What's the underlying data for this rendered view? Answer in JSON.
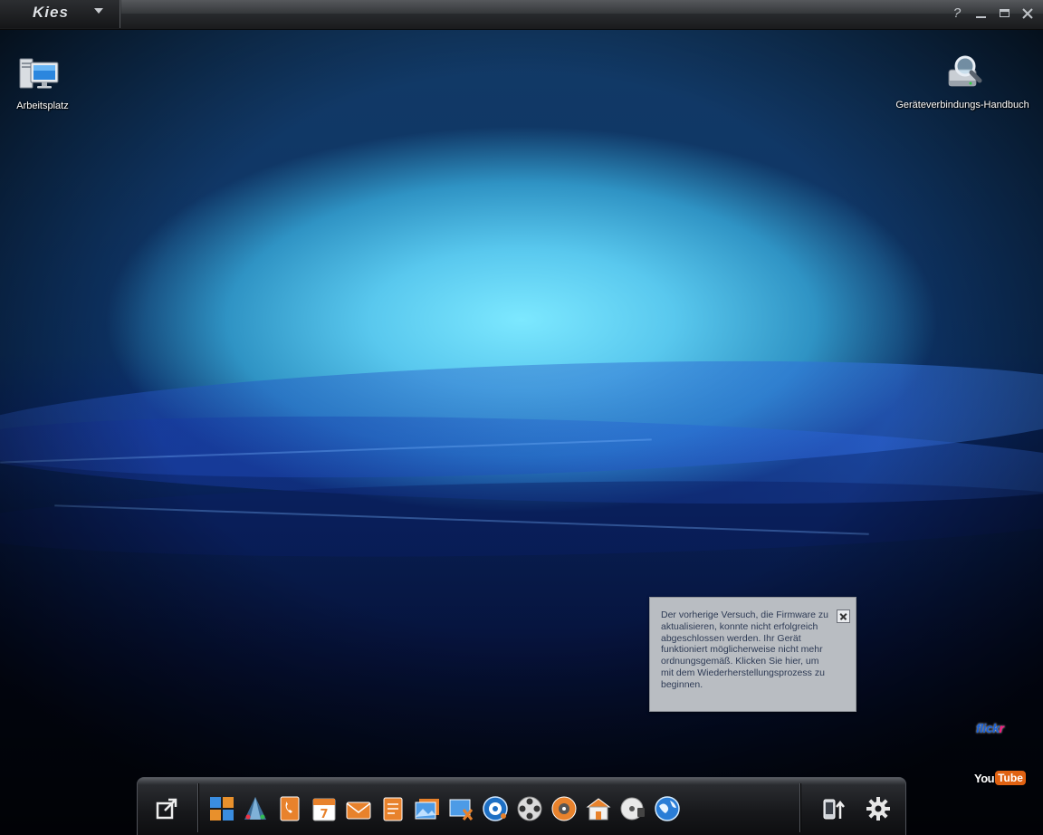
{
  "window": {
    "app_logo": "Kies",
    "controls": [
      "help-icon",
      "minimize-icon",
      "maximize-icon",
      "close-icon"
    ],
    "help_glyph": "?"
  },
  "desktop": {
    "icons": [
      {
        "label": "Arbeitsplatz",
        "icon": "computer-icon"
      },
      {
        "label": "Geräteverbindungs-Handbuch",
        "icon": "manual-search-icon"
      }
    ]
  },
  "notification": {
    "message": "Der vorherige Versuch, die Firmware zu aktualisieren, konnte nicht erfolgreich abgeschlossen werden. Ihr Gerät funktioniert möglicherweise nicht mehr ordnungsgemäß. Klicken Sie hier, um mit dem Wiederherstellungsprozess zu beginnen."
  },
  "social": {
    "flickr_a": "flick",
    "flickr_b": "r",
    "youtube_you": "You",
    "youtube_tube": "Tube"
  },
  "dock": {
    "items": [
      "external-open-icon",
      "apps-icon",
      "connect-icon",
      "phonebook-icon",
      "calendar-icon",
      "message-icon",
      "memo-icon",
      "photo-icon",
      "photo-edit-icon",
      "music-icon",
      "video-icon",
      "podcast-icon",
      "store-icon",
      "cd-icon",
      "globe-icon",
      "device-update-icon",
      "settings-icon"
    ],
    "calendar_day": "7"
  },
  "colors": {
    "titlebar": "#26282b",
    "sky": "#7ce8ff",
    "notification_bg": "#b9bdc2",
    "notification_text": "#2e3b55",
    "flickr_blue": "#1960d6",
    "flickr_pink": "#ff1381",
    "youtube_red": "#e06212"
  }
}
